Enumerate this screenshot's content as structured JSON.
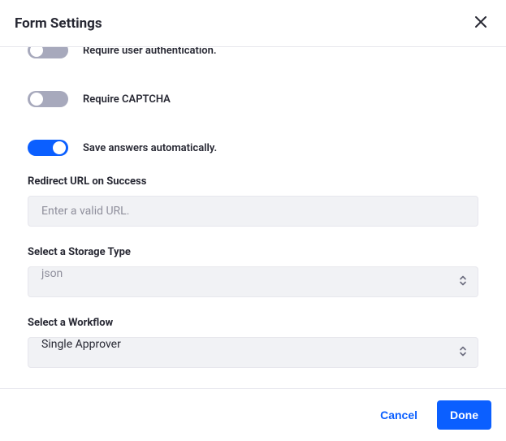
{
  "header": {
    "title": "Form Settings"
  },
  "toggles": {
    "require_auth": {
      "label": "Require user authentication.",
      "on": false
    },
    "require_captcha": {
      "label": "Require CAPTCHA",
      "on": false
    },
    "autosave": {
      "label": "Save answers automatically.",
      "on": true
    }
  },
  "fields": {
    "redirect": {
      "label": "Redirect URL on Success",
      "placeholder": "Enter a valid URL.",
      "value": ""
    },
    "storage": {
      "label": "Select a Storage Type",
      "value": "json"
    },
    "workflow": {
      "label": "Select a Workflow",
      "value": "Single Approver"
    }
  },
  "footer": {
    "cancel": "Cancel",
    "done": "Done"
  }
}
